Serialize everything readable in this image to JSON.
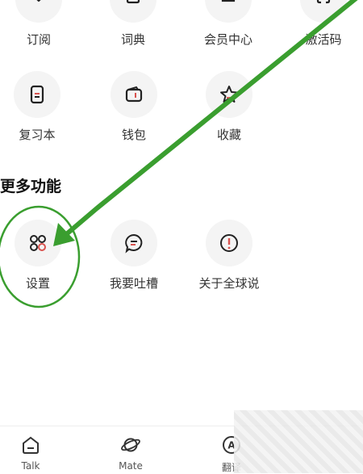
{
  "grid_top": [
    {
      "label": "订阅",
      "icon": "subscribe-icon"
    },
    {
      "label": "词典",
      "icon": "dictionary-icon"
    },
    {
      "label": "会员中心",
      "icon": "member-center-icon"
    },
    {
      "label": "激活码",
      "icon": "activation-code-icon"
    }
  ],
  "grid_mid": [
    {
      "label": "复习本",
      "icon": "review-book-icon"
    },
    {
      "label": "钱包",
      "icon": "wallet-icon"
    },
    {
      "label": "收藏",
      "icon": "star-icon"
    }
  ],
  "section_title": "更多功能",
  "grid_more": [
    {
      "label": "设置",
      "icon": "settings-icon"
    },
    {
      "label": "我要吐槽",
      "icon": "feedback-icon"
    },
    {
      "label": "关于全球说",
      "icon": "about-icon"
    }
  ],
  "bottom_tabs": [
    {
      "label": "Talk",
      "icon": "talk-icon"
    },
    {
      "label": "Mate",
      "icon": "planet-icon"
    },
    {
      "label": "翻译",
      "icon": "translate-icon"
    }
  ],
  "colors": {
    "annotation_green": "#3a9e2f",
    "accent_red": "#d9534f"
  }
}
